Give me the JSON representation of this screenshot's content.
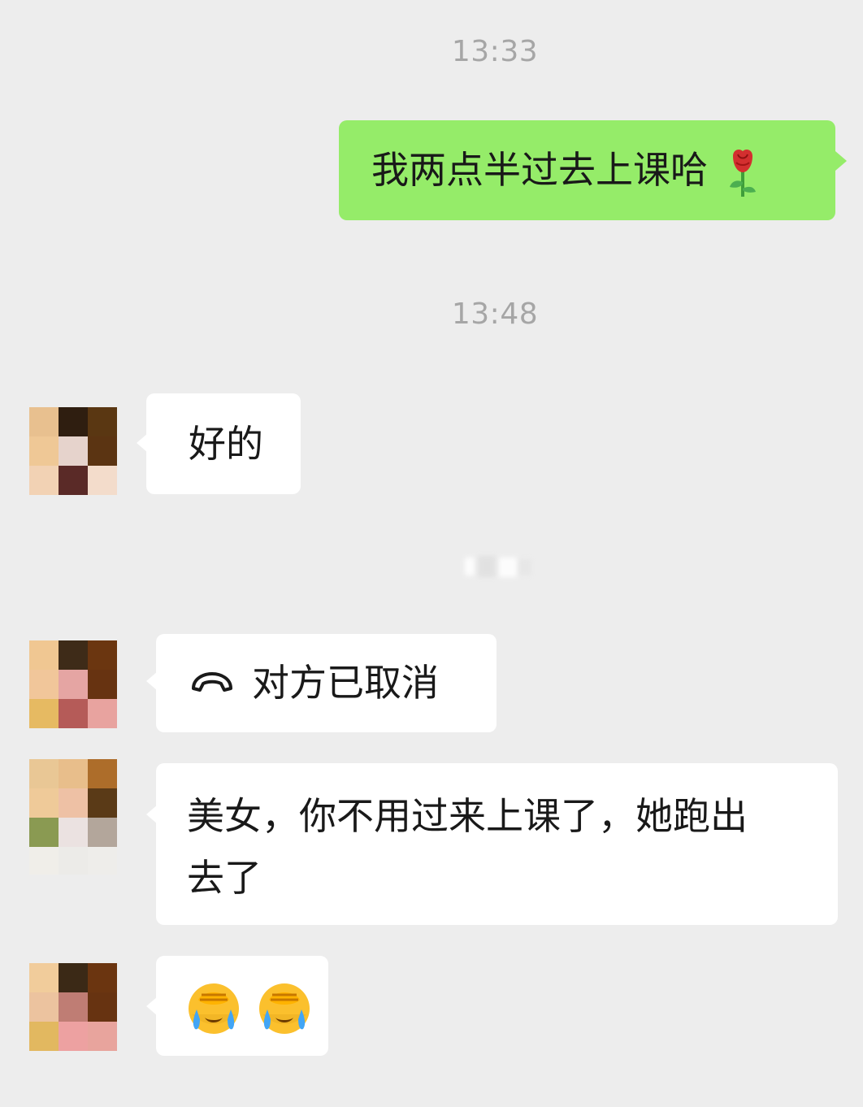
{
  "chat": {
    "timestamps": [
      "13:33",
      "13:48"
    ],
    "messages": [
      {
        "from": "me",
        "type": "text",
        "text": "我两点半过去上课哈",
        "emoji": "rose-icon"
      },
      {
        "from": "contact",
        "type": "text",
        "text": "好的"
      },
      {
        "from": "contact",
        "type": "call",
        "icon": "hangup-icon",
        "text": "对方已取消"
      },
      {
        "from": "contact",
        "type": "text",
        "line1": "美女，你不用过来上课了，她跑出",
        "line2": "去了"
      },
      {
        "from": "contact",
        "type": "emoji",
        "emojis": [
          "facepalm-crying-emoji",
          "facepalm-crying-emoji"
        ]
      }
    ]
  },
  "colors": {
    "background": "#ededed",
    "outgoing_bubble": "#95ec69",
    "incoming_bubble": "#ffffff",
    "timestamp": "#a6a6a6"
  }
}
